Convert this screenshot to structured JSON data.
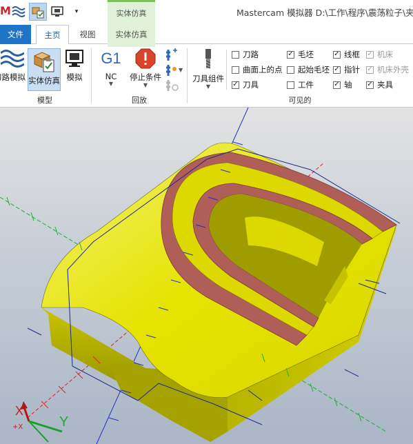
{
  "titlebar": {
    "logo_text": "M",
    "context_tab": "实体仿真",
    "window_title": "Mastercam 模拟器  D:\\工作\\程序\\震荡粒子\\夹片"
  },
  "tabs": {
    "file": "文件",
    "home": "主页",
    "view": "视图",
    "simulation": "实体仿真"
  },
  "ribbon": {
    "model_group": {
      "label": "模型",
      "toolpath_sim": "刀路模拟",
      "solid_sim": "实体仿真",
      "simulate": "模拟"
    },
    "playback_group": {
      "label": "回放",
      "nc_icon": "G1",
      "nc": "NC",
      "stop_conditions": "停止条件"
    },
    "visible_group": {
      "label": "可见的",
      "tool_assembly": "刀具组件",
      "checkboxes": [
        {
          "label": "刀路",
          "checked": false,
          "disabled": false
        },
        {
          "label": "毛坯",
          "checked": true,
          "disabled": false
        },
        {
          "label": "线框",
          "checked": true,
          "disabled": false
        },
        {
          "label": "机床",
          "checked": true,
          "disabled": true
        },
        {
          "label": "曲面上的点",
          "checked": false,
          "disabled": false
        },
        {
          "label": "起始毛坯",
          "checked": false,
          "disabled": false
        },
        {
          "label": "指针",
          "checked": true,
          "disabled": false
        },
        {
          "label": "机床外壳",
          "checked": true,
          "disabled": true
        },
        {
          "label": "刀具",
          "checked": true,
          "disabled": false
        },
        {
          "label": "工件",
          "checked": false,
          "disabled": false
        },
        {
          "label": "轴",
          "checked": true,
          "disabled": false
        },
        {
          "label": "夹具",
          "checked": true,
          "disabled": false
        }
      ]
    }
  },
  "viewport": {
    "axis_x": "X",
    "axis_x_sub": "+X",
    "axis_y": "Y",
    "colors": {
      "part": "#e9e600",
      "part_shadow": "#a5a200",
      "groove": "#b05e58",
      "axis_x": "#e02020",
      "axis_y": "#18b030",
      "axis_z": "#2030c0"
    }
  }
}
